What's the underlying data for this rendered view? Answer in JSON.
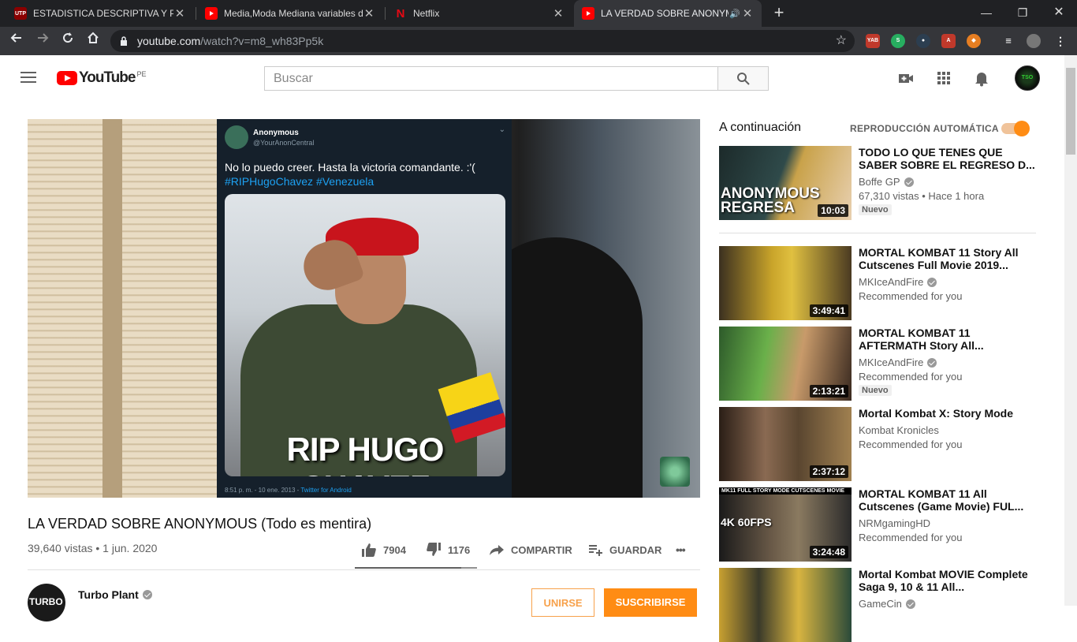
{
  "browser": {
    "tabs": [
      {
        "title": "ESTADISTICA DESCRIPTIVA Y PRO",
        "favicon": "utp-icon",
        "favicon_text": "UTP"
      },
      {
        "title": "Media,Moda Mediana variables d",
        "favicon": "youtube-icon"
      },
      {
        "title": "Netflix",
        "favicon": "netflix-icon",
        "favicon_text": "N"
      },
      {
        "title": "LA VERDAD SOBRE ANONYM",
        "favicon": "youtube-icon",
        "active": true
      }
    ],
    "url_host": "youtube.com",
    "url_path": "/watch?v=m8_wh83Pp5k"
  },
  "masthead": {
    "logo_text": "YouTube",
    "country_code": "PE",
    "search_placeholder": "Buscar"
  },
  "video": {
    "tweet_name": "Anonymous",
    "tweet_handle": "@YourAnonCentral",
    "tweet_text": "No lo puedo creer. Hasta la victoria comandante. :'(",
    "tweet_tags": "#RIPHugoChavez #Venezuela",
    "tweet_image_caption": "RIP HUGO CHAVEZ",
    "tweet_time": "8:51 p. m. - 10 ene. 2013 - ",
    "tweet_source": "Twitter for Android",
    "title": "LA VERDAD SOBRE ANONYMOUS (Todo es mentira)",
    "views_date": "39,640 vistas • 1 jun. 2020",
    "likes": "7904",
    "like_ratio": 0.87,
    "dislikes": "1176",
    "share_label": "COMPARTIR",
    "save_label": "GUARDAR",
    "more_label": "•••",
    "channel_name": "Turbo Plant",
    "channel_avatar_text": "TURBO",
    "join_label": "UNIRSE",
    "subscribe_label": "SUSCRIBIRSE"
  },
  "sidebar": {
    "up_next_label": "A continuación",
    "autoplay_label": "REPRODUCCIÓN AUTOMÁTICA",
    "autoplay_on": true,
    "accent_color": "#ff8c14",
    "items": [
      {
        "title": "TODO LO QUE TENES QUE SABER SOBRE EL REGRESO D...",
        "channel": "Boffe GP",
        "meta": "67,310 vistas • Hace 1 hora",
        "badge": "Nuevo",
        "duration": "10:03",
        "thumb_caption": "ANONYMOUS REGRESA"
      },
      {
        "title": "MORTAL KOMBAT 11 Story All Cutscenes Full Movie 2019...",
        "channel": "MKIceAndFire",
        "meta": "Recommended for you",
        "badge": "",
        "duration": "3:49:41",
        "thumb_caption": ""
      },
      {
        "title": "MORTAL KOMBAT 11 AFTERMATH Story All...",
        "channel": "MKIceAndFire",
        "meta": "Recommended for you",
        "badge": "Nuevo",
        "duration": "2:13:21",
        "thumb_caption": ""
      },
      {
        "title": "Mortal Kombat X: Story Mode",
        "channel": "Kombat Kronicles",
        "meta": "Recommended for you",
        "badge": "",
        "duration": "2:37:12",
        "thumb_caption": ""
      },
      {
        "title": "MORTAL KOMBAT 11 All Cutscenes (Game Movie) FUL...",
        "channel": "NRMgamingHD",
        "meta": "Recommended for you",
        "badge": "",
        "duration": "3:24:48",
        "thumb_caption": "MK11 FULL STORY MODE CUTSCENES MOVIE",
        "thumb_caption2": "4K 60FPS"
      },
      {
        "title": "Mortal Kombat MOVIE Complete Saga 9, 10 & 11 All...",
        "channel": "GameCin",
        "meta": "",
        "badge": "",
        "duration": "",
        "thumb_caption": ""
      }
    ]
  }
}
